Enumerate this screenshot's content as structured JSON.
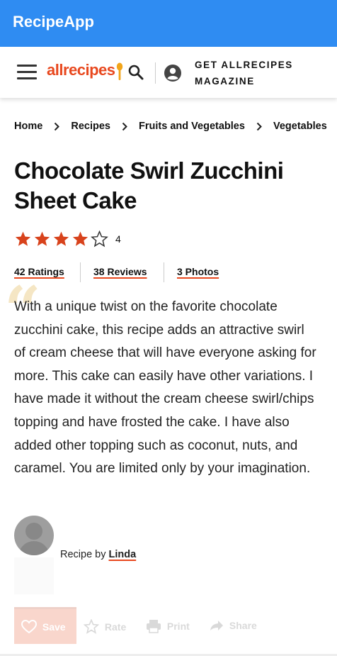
{
  "app": {
    "title": "RecipeApp"
  },
  "header": {
    "logo_text": "allrecipes",
    "magazine_line1": "GET ALLRECIPES",
    "magazine_line2": "MAGAZINE",
    "icons": [
      "menu-icon",
      "spoon-icon",
      "search-icon",
      "account-icon"
    ]
  },
  "breadcrumb": [
    "Home",
    "Recipes",
    "Fruits and Vegetables",
    "Vegetables"
  ],
  "recipe": {
    "title": "Chocolate Swirl Zucchini Sheet Cake",
    "rating": 4,
    "rating_max": 5,
    "rating_label": "4",
    "ratings": "42 Ratings",
    "reviews": "38 Reviews",
    "photos": "3 Photos",
    "description": "With a unique twist on the favorite chocolate zucchini cake, this recipe adds an attractive swirl of cream cheese that will have everyone asking for more. This cake can easily have other variations. I have made it without the cream cheese swirl/chips topping and have frosted the cake. I have also added other topping such as coconut, nuts, and caramel. You are limited only by your imagination.",
    "byline_prefix": "Recipe by",
    "author": "Linda"
  },
  "actions": {
    "save": "Save",
    "rate": "Rate",
    "print": "Print",
    "share": "Share"
  },
  "colors": {
    "app_bar": "#2f8cf2",
    "brand": "#e8481e",
    "star": "#d8431c"
  }
}
